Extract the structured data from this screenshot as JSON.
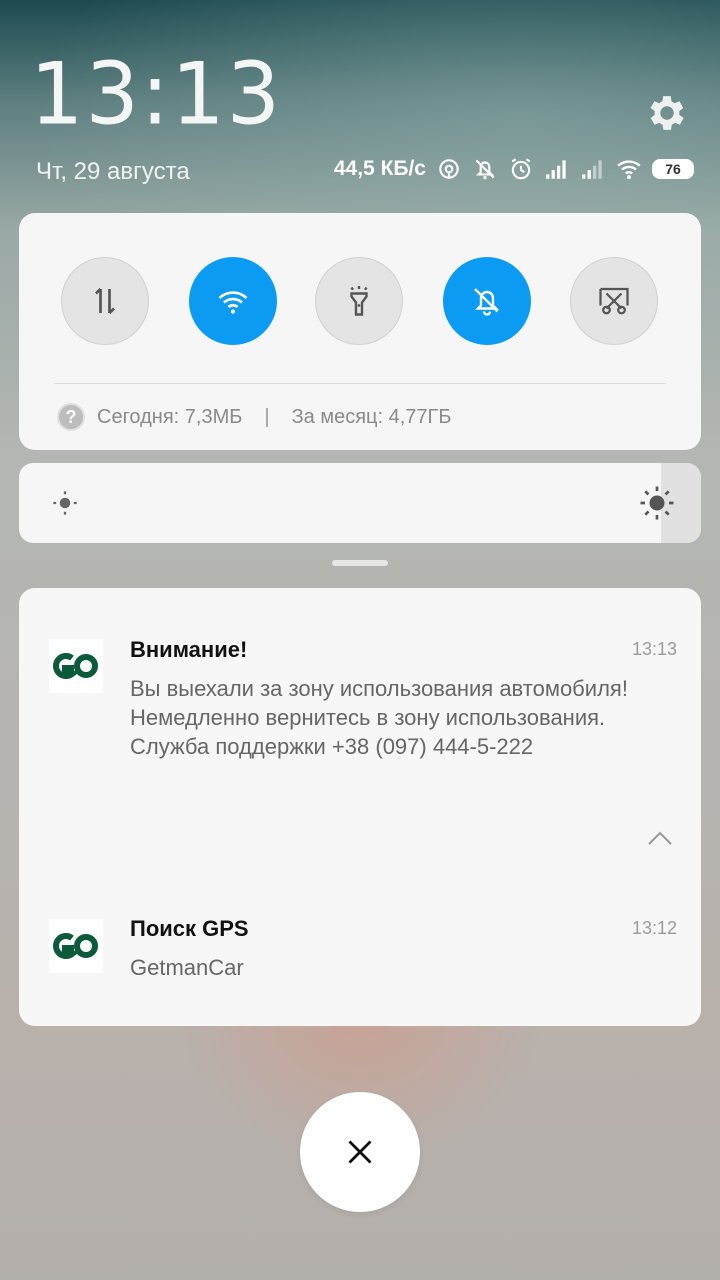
{
  "header": {
    "time": "13:13",
    "date": "Чт, 29 августа"
  },
  "status_bar": {
    "net_speed": "44,5 КБ/с",
    "battery_level": "76",
    "icons": [
      "hotspot-icon",
      "do-not-disturb-icon",
      "alarm-icon",
      "signal-icon",
      "signal-icon",
      "wifi-icon"
    ]
  },
  "quick_settings": {
    "toggles": [
      {
        "name": "mobile-data",
        "icon": "data-transfer-icon",
        "active": false
      },
      {
        "name": "wifi",
        "icon": "wifi-icon",
        "active": true
      },
      {
        "name": "flashlight",
        "icon": "flashlight-icon",
        "active": false
      },
      {
        "name": "silent",
        "icon": "bell-off-icon",
        "active": true
      },
      {
        "name": "screenshot",
        "icon": "scissors-icon",
        "active": false
      }
    ],
    "usage_today": "Сегодня: 7,3МБ",
    "usage_separator": "|",
    "usage_month": "За месяц: 4,77ГБ"
  },
  "brightness": {
    "level": 0.97
  },
  "notifications": [
    {
      "title": "Внимание!",
      "time": "13:13",
      "body": "Вы выехали за зону использования автомобиля! Немедленно вернитесь в зону использования. Служба поддержки +38 (097) 444-5-222"
    },
    {
      "title": "Поиск GPS",
      "time": "13:12",
      "body": "GetmanCar"
    }
  ],
  "colors": {
    "accent": "#0c9bf2",
    "app_logo": "#0b5a3c"
  }
}
